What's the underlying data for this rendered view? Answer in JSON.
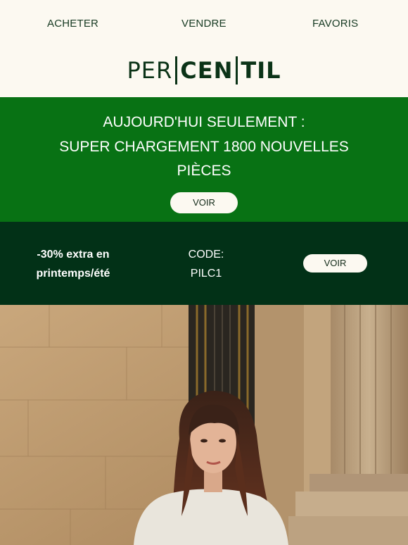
{
  "nav": {
    "items": [
      "ACHETER",
      "VENDRE",
      "FAVORIS"
    ]
  },
  "logo": {
    "parts": [
      "PER",
      "CEN",
      "TIL"
    ]
  },
  "promo": {
    "line1": "AUJOURD'HUI SEULEMENT :",
    "line2": "SUPER CHARGEMENT 1800 NOUVELLES",
    "line3": "PIÈCES",
    "button": "VOIR",
    "background": "#087214"
  },
  "code_band": {
    "offer_line1": "-30% extra en",
    "offer_line2": "printemps/été",
    "code_label": "CODE:",
    "code_value": "PILC1",
    "button": "VOIR",
    "background": "#023117"
  }
}
